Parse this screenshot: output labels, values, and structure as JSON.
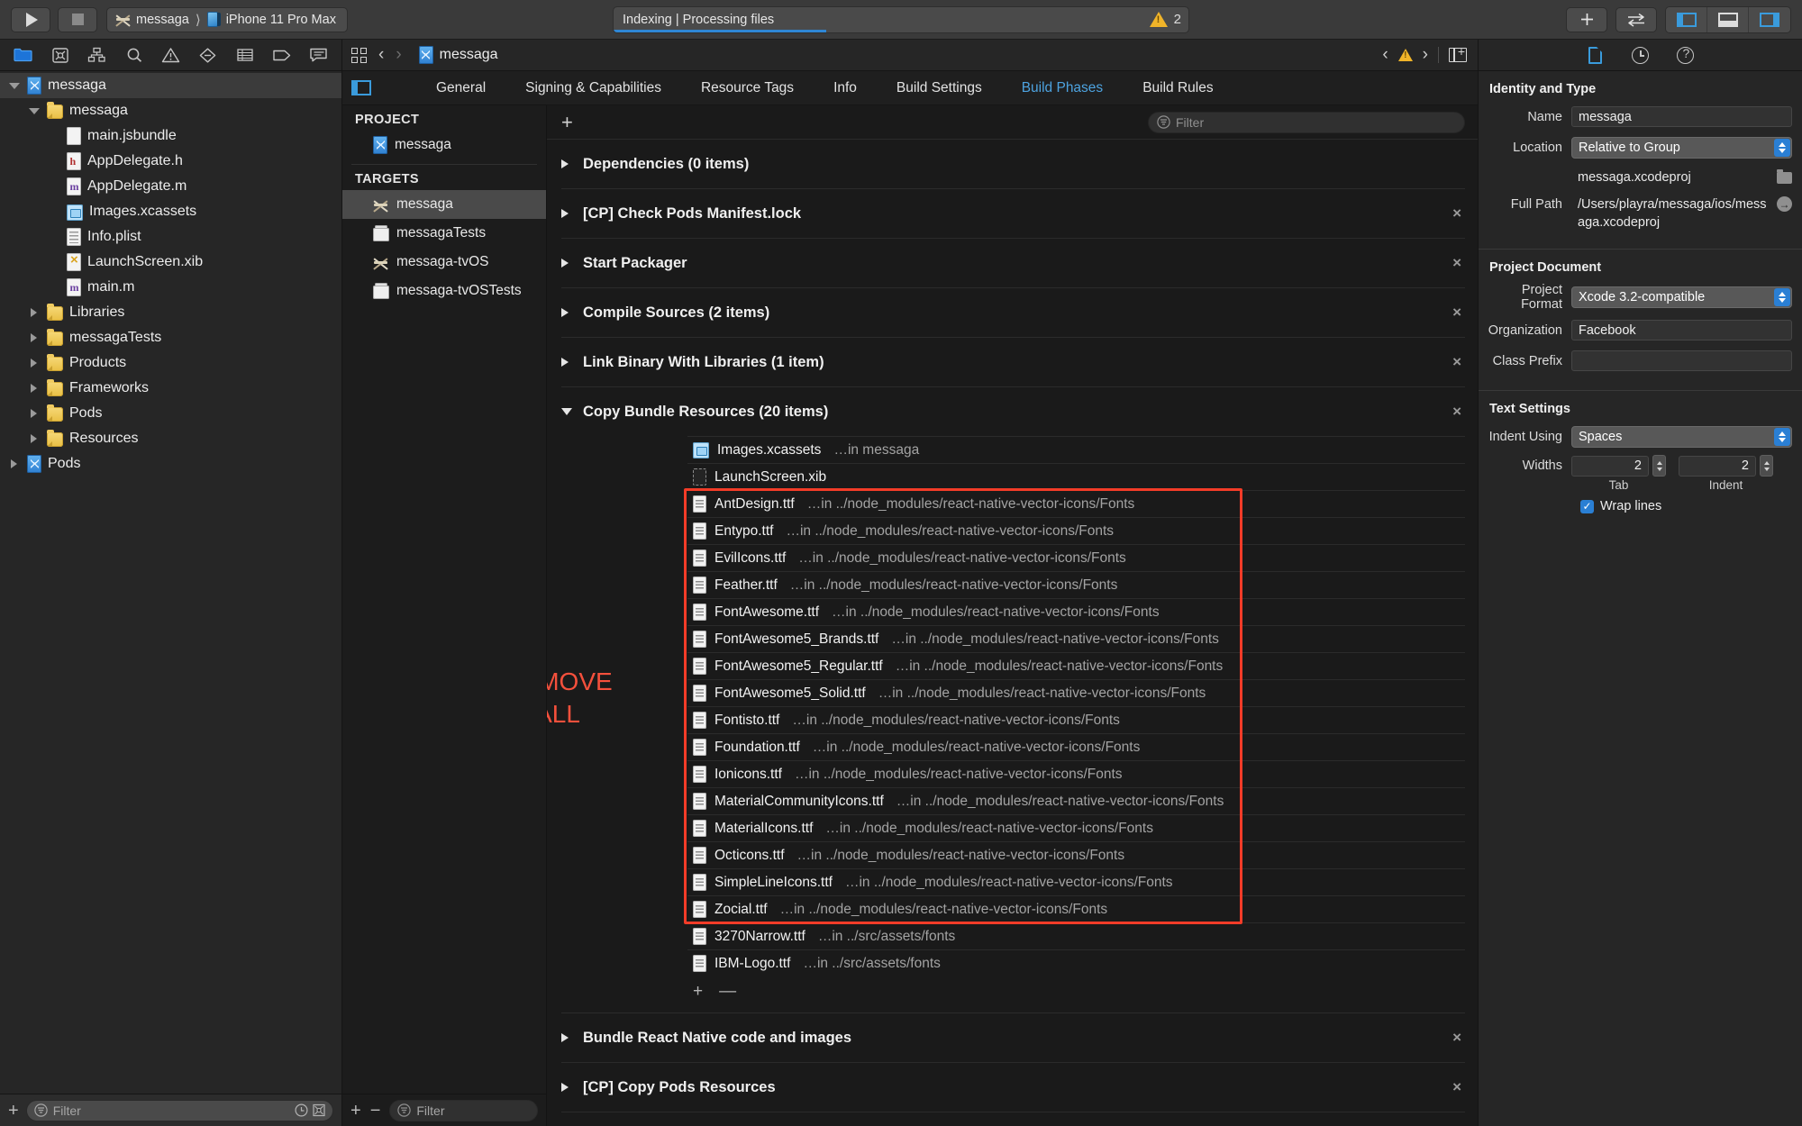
{
  "toolbar": {
    "run_label": "Run",
    "stop_label": "Stop",
    "scheme": "messaga",
    "destination": "iPhone 11 Pro Max",
    "status_text": "Indexing | Processing files",
    "warning_count": "2",
    "progress_percent": 37,
    "add_label": "+",
    "accent_blue": "#2f86d4",
    "warning_color": "#f0b429"
  },
  "navigator": {
    "toolbar_icons": [
      "folder-icon",
      "source-control-icon",
      "symbol-hierarchy-icon",
      "search-icon",
      "issue-warning-icon",
      "test-icon",
      "debug-icon",
      "breakpoint-icon",
      "report-icon"
    ],
    "tree": [
      {
        "label": "messaga",
        "icon": "project-icon",
        "indent": 0,
        "twisty": "open",
        "selected": true
      },
      {
        "label": "messaga",
        "icon": "folder-icon",
        "indent": 1,
        "twisty": "open",
        "selected": false
      },
      {
        "label": "main.jsbundle",
        "icon": "file-icon",
        "indent": 2,
        "twisty": "none",
        "selected": false
      },
      {
        "label": "AppDelegate.h",
        "icon": "header-file-icon",
        "indent": 2,
        "twisty": "none",
        "selected": false
      },
      {
        "label": "AppDelegate.m",
        "icon": "objc-file-icon",
        "indent": 2,
        "twisty": "none",
        "selected": false
      },
      {
        "label": "Images.xcassets",
        "icon": "xcassets-icon",
        "indent": 2,
        "twisty": "none",
        "selected": false
      },
      {
        "label": "Info.plist",
        "icon": "plist-file-icon",
        "indent": 2,
        "twisty": "none",
        "selected": false
      },
      {
        "label": "LaunchScreen.xib",
        "icon": "xib-file-icon",
        "indent": 2,
        "twisty": "none",
        "selected": false
      },
      {
        "label": "main.m",
        "icon": "objc-file-icon",
        "indent": 2,
        "twisty": "none",
        "selected": false
      },
      {
        "label": "Libraries",
        "icon": "folder-icon",
        "indent": 1,
        "twisty": "closed",
        "selected": false
      },
      {
        "label": "messagaTests",
        "icon": "folder-icon",
        "indent": 1,
        "twisty": "closed",
        "selected": false
      },
      {
        "label": "Products",
        "icon": "folder-icon",
        "indent": 1,
        "twisty": "closed",
        "selected": false
      },
      {
        "label": "Frameworks",
        "icon": "folder-icon",
        "indent": 1,
        "twisty": "closed",
        "selected": false
      },
      {
        "label": "Pods",
        "icon": "folder-icon",
        "indent": 1,
        "twisty": "closed",
        "selected": false
      },
      {
        "label": "Resources",
        "icon": "folder-icon",
        "indent": 1,
        "twisty": "closed",
        "selected": false
      },
      {
        "label": "Pods",
        "icon": "project-icon",
        "indent": 0,
        "twisty": "closed",
        "selected": false
      }
    ],
    "filter_placeholder": "Filter"
  },
  "jumpbar": {
    "breadcrumb": "messaga"
  },
  "tabs": [
    {
      "label": "General",
      "active": false
    },
    {
      "label": "Signing & Capabilities",
      "active": false
    },
    {
      "label": "Resource Tags",
      "active": false
    },
    {
      "label": "Info",
      "active": false
    },
    {
      "label": "Build Settings",
      "active": false
    },
    {
      "label": "Build Phases",
      "active": true
    },
    {
      "label": "Build Rules",
      "active": false
    }
  ],
  "targets_panel": {
    "project_header": "PROJECT",
    "targets_header": "TARGETS",
    "project_items": [
      {
        "label": "messaga",
        "icon": "project-icon"
      }
    ],
    "target_items": [
      {
        "label": "messaga",
        "icon": "target-app-icon",
        "selected": true
      },
      {
        "label": "messagaTests",
        "icon": "target-bundle-icon",
        "selected": false
      },
      {
        "label": "messaga-tvOS",
        "icon": "target-app-icon",
        "selected": false
      },
      {
        "label": "messaga-tvOSTests",
        "icon": "target-bundle-icon",
        "selected": false
      }
    ],
    "filter_placeholder": "Filter"
  },
  "phases_panel": {
    "filter_placeholder": "Filter",
    "phases": [
      {
        "title": "Dependencies (0 items)",
        "expanded": false,
        "removable": false
      },
      {
        "title": "[CP] Check Pods Manifest.lock",
        "expanded": false,
        "removable": true
      },
      {
        "title": "Start Packager",
        "expanded": false,
        "removable": true
      },
      {
        "title": "Compile Sources (2 items)",
        "expanded": false,
        "removable": true
      },
      {
        "title": "Link Binary With Libraries (1 item)",
        "expanded": false,
        "removable": true
      },
      {
        "title": "Copy Bundle Resources (20 items)",
        "expanded": true,
        "removable": true
      },
      {
        "title": "Bundle React Native code and images",
        "expanded": false,
        "removable": true
      },
      {
        "title": "[CP] Copy Pods Resources",
        "expanded": false,
        "removable": true
      }
    ],
    "copy_bundle_resources": [
      {
        "name": "Images.xcassets",
        "path": "…in messaga",
        "icon": "xcassets-icon",
        "highlighted": false
      },
      {
        "name": "LaunchScreen.xib",
        "path": "",
        "icon": "xib-file-icon",
        "highlighted": false
      },
      {
        "name": "AntDesign.ttf",
        "path": "…in ../node_modules/react-native-vector-icons/Fonts",
        "icon": "font-file-icon",
        "highlighted": true
      },
      {
        "name": "Entypo.ttf",
        "path": "…in ../node_modules/react-native-vector-icons/Fonts",
        "icon": "font-file-icon",
        "highlighted": true
      },
      {
        "name": "EvilIcons.ttf",
        "path": "…in ../node_modules/react-native-vector-icons/Fonts",
        "icon": "font-file-icon",
        "highlighted": true
      },
      {
        "name": "Feather.ttf",
        "path": "…in ../node_modules/react-native-vector-icons/Fonts",
        "icon": "font-file-icon",
        "highlighted": true
      },
      {
        "name": "FontAwesome.ttf",
        "path": "…in ../node_modules/react-native-vector-icons/Fonts",
        "icon": "font-file-icon",
        "highlighted": true
      },
      {
        "name": "FontAwesome5_Brands.ttf",
        "path": "…in ../node_modules/react-native-vector-icons/Fonts",
        "icon": "font-file-icon",
        "highlighted": true
      },
      {
        "name": "FontAwesome5_Regular.ttf",
        "path": "…in ../node_modules/react-native-vector-icons/Fonts",
        "icon": "font-file-icon",
        "highlighted": true
      },
      {
        "name": "FontAwesome5_Solid.ttf",
        "path": "…in ../node_modules/react-native-vector-icons/Fonts",
        "icon": "font-file-icon",
        "highlighted": true
      },
      {
        "name": "Fontisto.ttf",
        "path": "…in ../node_modules/react-native-vector-icons/Fonts",
        "icon": "font-file-icon",
        "highlighted": true
      },
      {
        "name": "Foundation.ttf",
        "path": "…in ../node_modules/react-native-vector-icons/Fonts",
        "icon": "font-file-icon",
        "highlighted": true
      },
      {
        "name": "Ionicons.ttf",
        "path": "…in ../node_modules/react-native-vector-icons/Fonts",
        "icon": "font-file-icon",
        "highlighted": true
      },
      {
        "name": "MaterialCommunityIcons.ttf",
        "path": "…in ../node_modules/react-native-vector-icons/Fonts",
        "icon": "font-file-icon",
        "highlighted": true
      },
      {
        "name": "MaterialIcons.ttf",
        "path": "…in ../node_modules/react-native-vector-icons/Fonts",
        "icon": "font-file-icon",
        "highlighted": true
      },
      {
        "name": "Octicons.ttf",
        "path": "…in ../node_modules/react-native-vector-icons/Fonts",
        "icon": "font-file-icon",
        "highlighted": true
      },
      {
        "name": "SimpleLineIcons.ttf",
        "path": "…in ../node_modules/react-native-vector-icons/Fonts",
        "icon": "font-file-icon",
        "highlighted": true
      },
      {
        "name": "Zocial.ttf",
        "path": "…in ../node_modules/react-native-vector-icons/Fonts",
        "icon": "font-file-icon",
        "highlighted": true
      },
      {
        "name": "3270Narrow.ttf",
        "path": "…in ../src/assets/fonts",
        "icon": "font-file-icon",
        "highlighted": false
      },
      {
        "name": "IBM-Logo.ttf",
        "path": "…in ../src/assets/fonts",
        "icon": "font-file-icon",
        "highlighted": false
      }
    ],
    "add_button": "+",
    "remove_button": "—"
  },
  "annotation": {
    "text": "REMOVE\nALL",
    "color": "#f4503c"
  },
  "inspector": {
    "tabs": [
      "file-inspector-icon",
      "history-inspector-icon",
      "quick-help-icon"
    ],
    "identity": {
      "title": "Identity and Type",
      "name_label": "Name",
      "name_value": "messaga",
      "location_label": "Location",
      "location_value": "Relative to Group",
      "location_file": "messaga.xcodeproj",
      "fullpath_label": "Full Path",
      "fullpath_value": "/Users/playra/messaga/ios/messaga.xcodeproj"
    },
    "document": {
      "title": "Project Document",
      "format_label": "Project Format",
      "format_value": "Xcode 3.2-compatible",
      "org_label": "Organization",
      "org_value": "Facebook",
      "prefix_label": "Class Prefix",
      "prefix_value": ""
    },
    "text_settings": {
      "title": "Text Settings",
      "indent_label": "Indent Using",
      "indent_value": "Spaces",
      "widths_label": "Widths",
      "tab_value": "2",
      "indent_value_num": "2",
      "tab_caption": "Tab",
      "indent_caption": "Indent",
      "wrap_label": "Wrap lines",
      "wrap_checked": true
    }
  }
}
